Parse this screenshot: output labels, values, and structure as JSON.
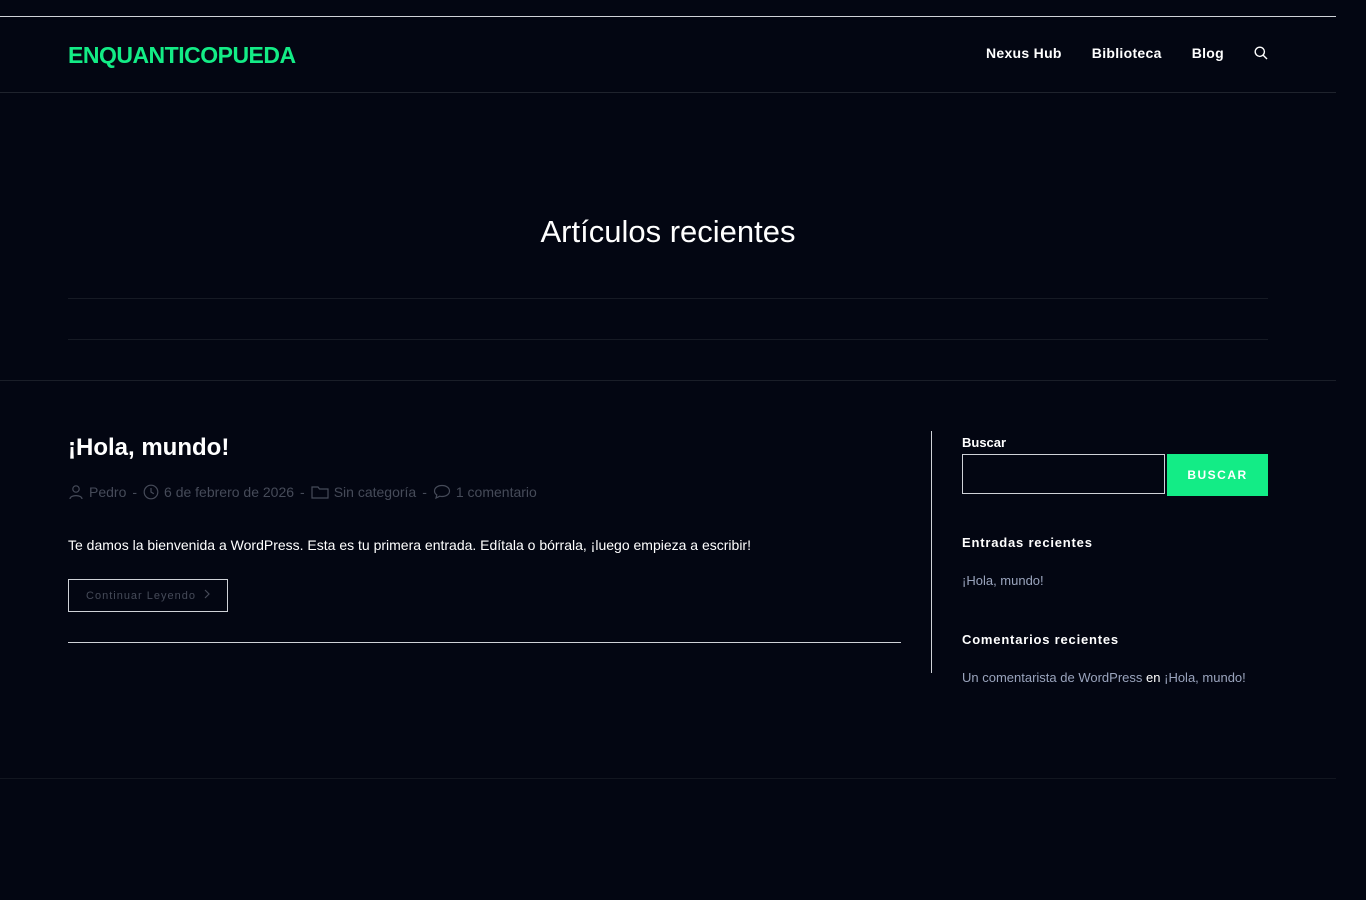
{
  "header": {
    "logo": "ENQUANTICOPUEDA",
    "nav": [
      "Nexus Hub",
      "Biblioteca",
      "Blog"
    ],
    "search_icon": "search-icon"
  },
  "page": {
    "title": "Artículos recientes"
  },
  "post": {
    "title": "¡Hola, mundo!",
    "meta": {
      "author": "Pedro",
      "date": "6 de febrero de 2026",
      "category": "Sin categoría",
      "comments": "1 comentario",
      "separator": "-"
    },
    "excerpt": "Te damos la bienvenida a WordPress. Esta es tu primera entrada. Edítala o bórrala, ¡luego empieza a escribir!",
    "continue_label": "Continuar Leyendo"
  },
  "sidebar": {
    "search_label": "Buscar",
    "search_value": "",
    "search_button": "BUSCAR",
    "recent_posts_title": "Entradas recientes",
    "recent_posts": [
      "¡Hola, mundo!"
    ],
    "recent_comments_title": "Comentarios recientes",
    "recent_comment": {
      "author": "Un comentarista de WordPress",
      "connector": "en",
      "post": "¡Hola, mundo!"
    }
  },
  "colors": {
    "background": "#030612",
    "accent": "#13ec86",
    "text": "#ffffff",
    "meta": "#464b59",
    "link": "#9aa4bd"
  }
}
